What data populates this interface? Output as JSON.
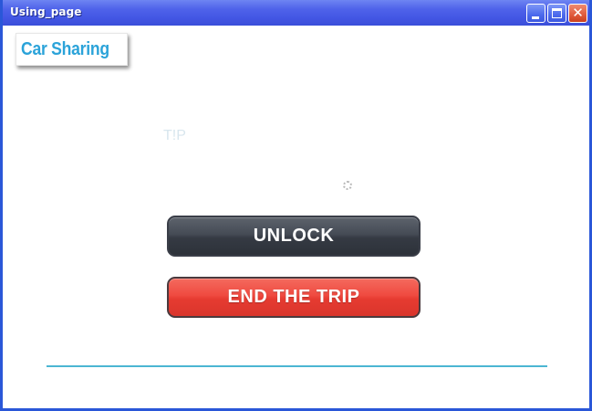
{
  "window": {
    "title": "Using_page",
    "controls": {
      "minimize_icon": "minimize-icon",
      "maximize_icon": "maximize-icon",
      "close_icon": "close-icon",
      "close_glyph": "✕"
    },
    "colors": {
      "titlebar": "#4356e4",
      "border": "#2a57d8",
      "close": "#e05a3c"
    }
  },
  "logo": {
    "text": "Car Sharing",
    "color": "#2ba3d9"
  },
  "status": {
    "faint_label": "T!P"
  },
  "actions": {
    "unlock_label": "UNLOCK",
    "end_trip_label": "END THE TRIP",
    "unlock_color": "#3a3f48",
    "end_trip_color": "#ef4a40"
  },
  "footer": {
    "divider_color": "#4cb6d3"
  }
}
